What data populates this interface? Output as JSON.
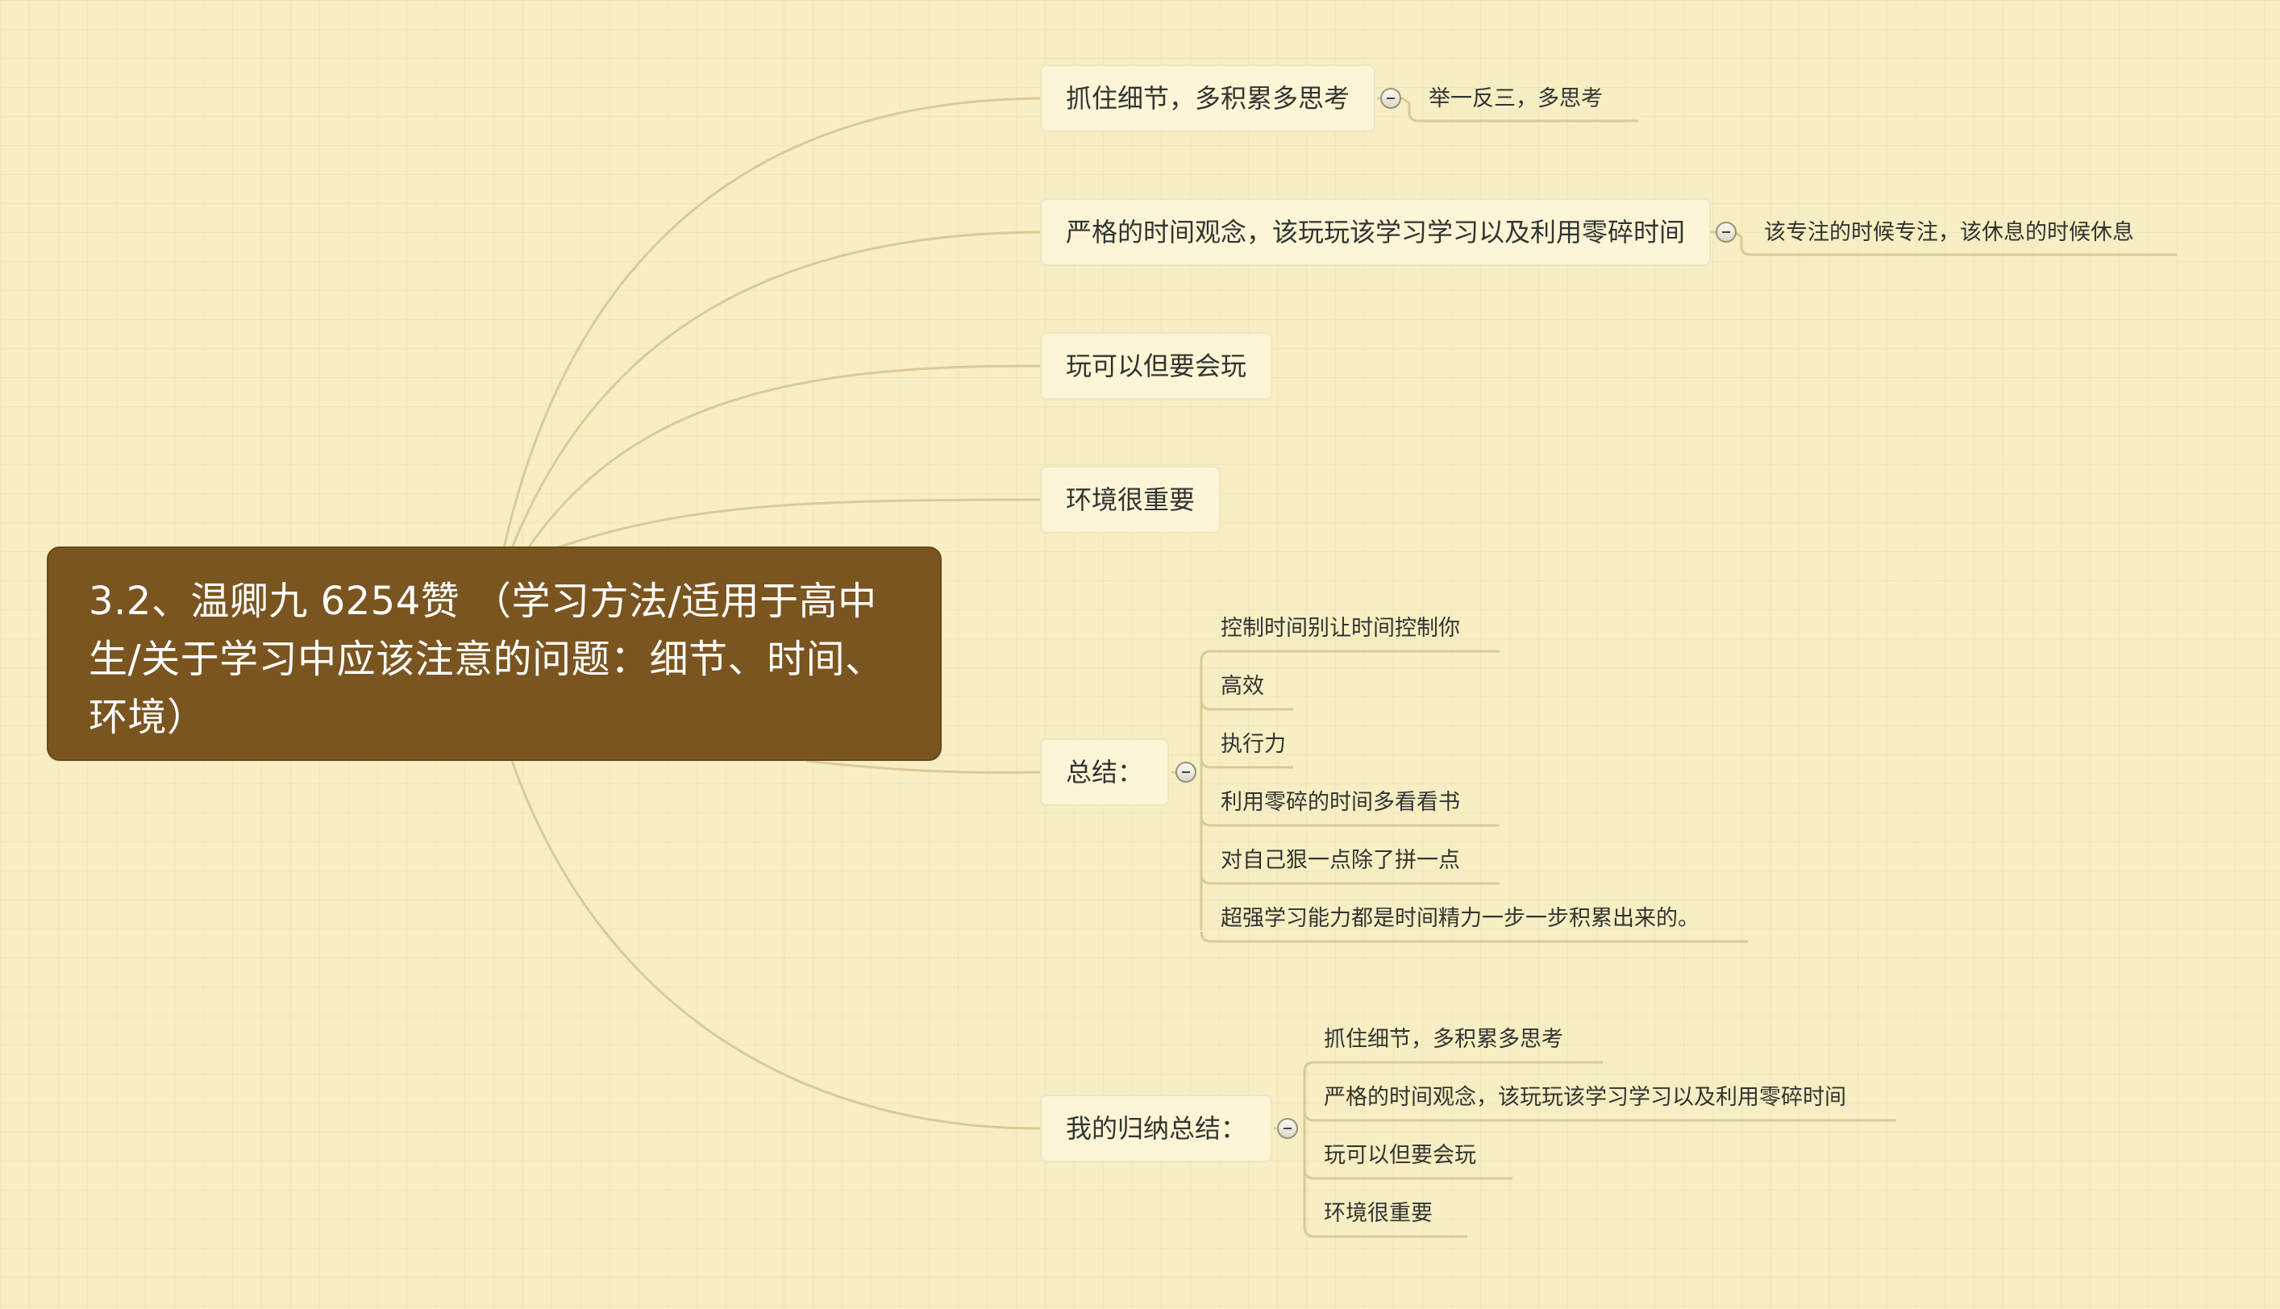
{
  "root": {
    "title": "3.2、温卿九 6254赞 （学习方法/适用于高中生/关于学习中应该注意的问题：细节、时间、环境）"
  },
  "branches": [
    {
      "label": "抓住细节，多积累多思考",
      "children": [
        "举一反三，多思考"
      ]
    },
    {
      "label": "严格的时间观念，该玩玩该学习学习以及利用零碎时间",
      "children": [
        "该专注的时候专注，该休息的时候休息"
      ]
    },
    {
      "label": "玩可以但要会玩",
      "children": []
    },
    {
      "label": "环境很重要",
      "children": []
    },
    {
      "label": "总结：",
      "children": [
        "控制时间别让时间控制你",
        "高效",
        "执行力",
        "利用零碎的时间多看看书",
        "对自己狠一点除了拼一点",
        "超强学习能力都是时间精力一步一步积累出来的。"
      ]
    },
    {
      "label": "我的归纳总结：",
      "children": [
        "抓住细节，多积累多思考",
        "严格的时间观念，该玩玩该学习学习以及利用零碎时间",
        "玩可以但要会玩",
        "环境很重要"
      ]
    }
  ],
  "colors": {
    "background": "#f7efc3",
    "root_fill": "#7b5520",
    "node_fill": "#fcf6d6",
    "connector": "#d9ca98"
  }
}
